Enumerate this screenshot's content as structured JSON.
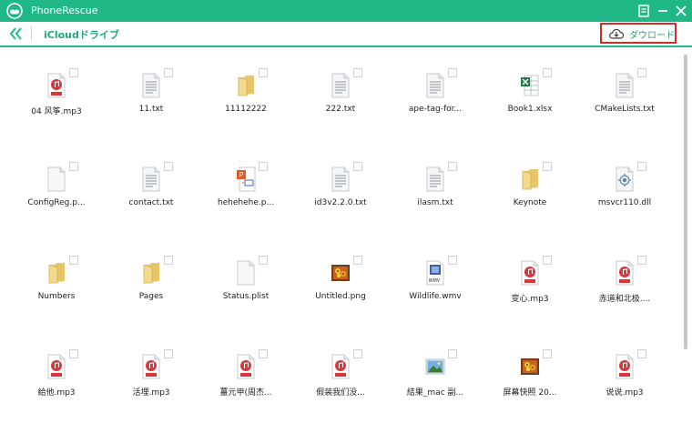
{
  "window": {
    "title": "PhoneRescue"
  },
  "toolbar": {
    "section_title": "iCloudドライブ",
    "download_label": "ダウロード"
  },
  "files": [
    {
      "name": "04 风筝.mp3",
      "type": "mp3"
    },
    {
      "name": "11.txt",
      "type": "txt"
    },
    {
      "name": "11112222",
      "type": "folder"
    },
    {
      "name": "222.txt",
      "type": "txt"
    },
    {
      "name": "ape-tag-for...",
      "type": "txt"
    },
    {
      "name": "Book1.xlsx",
      "type": "xlsx"
    },
    {
      "name": "CMakeLists.txt",
      "type": "txt"
    },
    {
      "name": "ConfigReg.p...",
      "type": "blank"
    },
    {
      "name": "contact.txt",
      "type": "txt"
    },
    {
      "name": "hehehehe.p...",
      "type": "ppt"
    },
    {
      "name": "id3v2.2.0.txt",
      "type": "txt"
    },
    {
      "name": "ilasm.txt",
      "type": "txt"
    },
    {
      "name": "Keynote",
      "type": "folder"
    },
    {
      "name": "msvcr110.dll",
      "type": "dll"
    },
    {
      "name": "Numbers",
      "type": "folder"
    },
    {
      "name": "Pages",
      "type": "folder"
    },
    {
      "name": "Status.plist",
      "type": "blank"
    },
    {
      "name": "Untitled.png",
      "type": "image"
    },
    {
      "name": "Wildlife.wmv",
      "type": "wmv"
    },
    {
      "name": "变心.mp3",
      "type": "mp3"
    },
    {
      "name": "赤道和北极....",
      "type": "mp3"
    },
    {
      "name": "給他.mp3",
      "type": "mp3"
    },
    {
      "name": "活埋.mp3",
      "type": "mp3"
    },
    {
      "name": "薑元甲(周杰...",
      "type": "mp3"
    },
    {
      "name": "假装我们没...",
      "type": "mp3"
    },
    {
      "name": "結果_mac 副...",
      "type": "landscape"
    },
    {
      "name": "屏幕快照 20...",
      "type": "image"
    },
    {
      "name": "说说.mp3",
      "type": "mp3"
    }
  ]
}
